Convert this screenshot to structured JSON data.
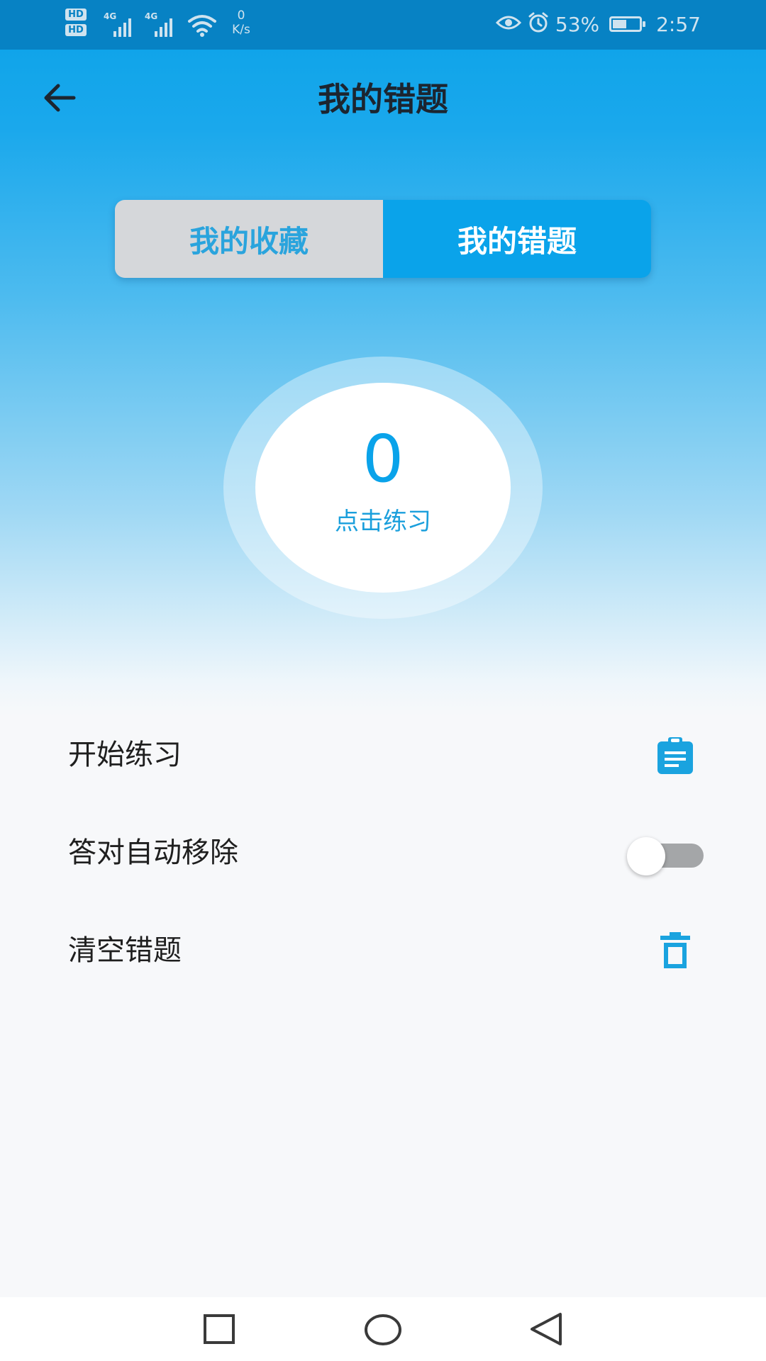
{
  "status_bar": {
    "hd1": "HD",
    "hd2": "HD",
    "sim1_tag": "4G",
    "sim2_tag": "4G",
    "net_speed_value": "0",
    "net_speed_unit": "K/s",
    "battery_percent": "53%",
    "battery_level": 0.53,
    "time": "2:57",
    "icons": [
      "hd-icon",
      "signal-icon",
      "signal-icon",
      "wifi-icon",
      "eye-icon",
      "alarm-icon",
      "battery-icon"
    ],
    "color": "#0782c4"
  },
  "header": {
    "title": "我的错题",
    "back_icon": "arrow-left-icon"
  },
  "segment": {
    "tabs": [
      {
        "label": "我的收藏",
        "active": false
      },
      {
        "label": "我的错题",
        "active": true
      }
    ],
    "active_color": "#0aa3ea",
    "inactive_color": "#d5d7da"
  },
  "summary": {
    "count": "0",
    "action_label": "点击练习"
  },
  "options": [
    {
      "label": "开始练习",
      "control": "clipboard-icon"
    },
    {
      "label": "答对自动移除",
      "control": "toggle",
      "on": false
    },
    {
      "label": "清空错题",
      "control": "trash-icon"
    }
  ],
  "accent_color": "#1aa3df",
  "nav_bar": {
    "icons": [
      "square-recents-icon",
      "circle-home-icon",
      "triangle-back-icon"
    ]
  }
}
